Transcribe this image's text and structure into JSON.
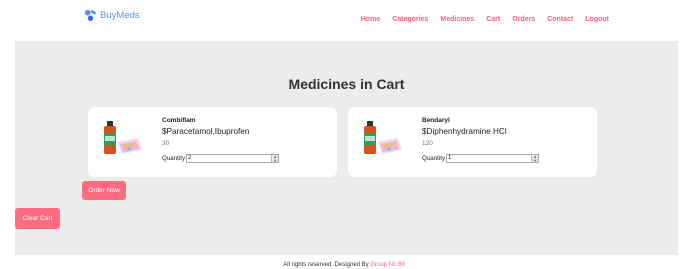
{
  "brand": {
    "name": "BuyMeds",
    "icon": "pills-icon",
    "color": "#5b8def"
  },
  "nav": [
    "Home",
    "Categories",
    "Medicines",
    "Cart",
    "Orders",
    "Contact",
    "Logout"
  ],
  "main": {
    "title": "Medicines in Cart"
  },
  "cart": [
    {
      "name": "Combiflam",
      "generic": "$Paracetamol,Ibuprofen",
      "price": "30",
      "qty_label": "Quantity",
      "qty": "2",
      "image": "medicine-bottle-icon"
    },
    {
      "name": "Bendaryl",
      "generic": "$Diphenhydramine HCl",
      "price": "120",
      "qty_label": "Quantity",
      "qty": "1",
      "image": "medicine-bottle-icon"
    }
  ],
  "actions": {
    "order": "Order Now",
    "clear": "Clear Cart"
  },
  "footer": {
    "text": "All rights reserved. Designed By ",
    "link": "Group No 69"
  },
  "colors": {
    "accent": "#ff6b81",
    "nav": "#ff5c7a",
    "panel": "#ececec"
  }
}
